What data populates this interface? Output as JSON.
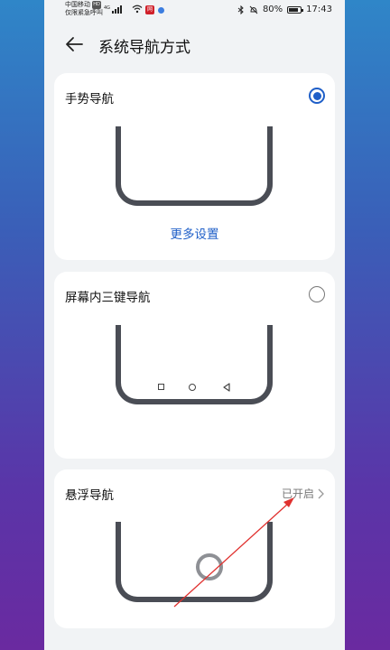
{
  "status_bar": {
    "carrier": "中国移动",
    "hd": "HD",
    "emergency": "仅限紧急呼叫",
    "network": "4G",
    "app_badge": "网",
    "battery": "80%",
    "battery_level": 0.8,
    "time": "17:43"
  },
  "header": {
    "title": "系统导航方式"
  },
  "options": {
    "gesture": {
      "title": "手势导航",
      "link": "更多设置",
      "selected": true
    },
    "three_key": {
      "title": "屏幕内三键导航",
      "selected": false
    },
    "floating": {
      "title": "悬浮导航",
      "status": "已开启"
    }
  },
  "colors": {
    "accent": "#1f5fc8",
    "annotation": "#e0312f"
  },
  "icons": [
    "back-arrow-icon",
    "radio-selected-icon",
    "radio-unselected-icon",
    "square-key-icon",
    "circle-key-icon",
    "triangle-back-key-icon",
    "chevron-right-icon",
    "bluetooth-icon",
    "mute-icon",
    "battery-icon",
    "wifi-icon",
    "signal-icon"
  ]
}
